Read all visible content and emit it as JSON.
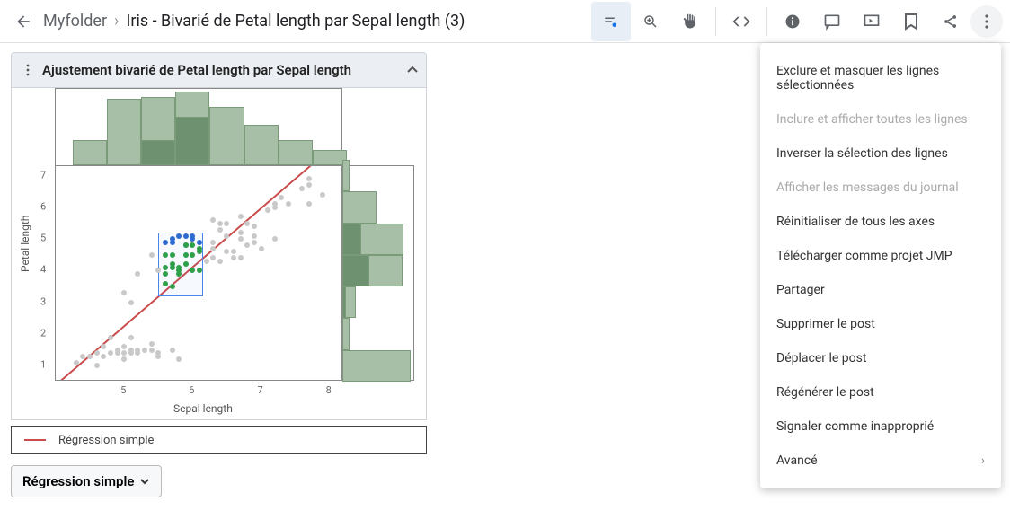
{
  "breadcrumb": {
    "folder": "Myfolder",
    "current": "Iris - Bivarié de Petal length par Sepal length (3)"
  },
  "panel": {
    "title": "Ajustement bivarié de Petal length par Sepal length"
  },
  "legend": {
    "label": "Régression simple"
  },
  "button": {
    "label": "Régression simple"
  },
  "axes": {
    "x": "Sepal length",
    "y": "Petal length"
  },
  "ticks": {
    "x": [
      "5",
      "6",
      "7",
      "8"
    ],
    "y": [
      "1",
      "2",
      "3",
      "4",
      "5",
      "6",
      "7"
    ]
  },
  "menu": {
    "items": [
      {
        "label": "Exclure et masquer les lignes sélectionnées",
        "disabled": false
      },
      {
        "label": "Inclure et afficher toutes les lignes",
        "disabled": true
      },
      {
        "label": "Inverser la sélection des lignes",
        "disabled": false
      },
      {
        "label": "Afficher les messages du journal",
        "disabled": true
      },
      {
        "label": "Réinitialiser de tous les axes",
        "disabled": false
      },
      {
        "label": "Télécharger comme projet JMP",
        "disabled": false
      },
      {
        "label": "Partager",
        "disabled": false
      },
      {
        "label": "Supprimer le post",
        "disabled": false
      },
      {
        "label": "Déplacer le post",
        "disabled": false
      },
      {
        "label": "Régénérer le post",
        "disabled": false
      },
      {
        "label": "Signaler comme inapproprié",
        "disabled": false
      },
      {
        "label": "Avancé",
        "disabled": false,
        "arrow": true
      }
    ]
  },
  "chart_data": {
    "type": "scatter",
    "title": "Ajustement bivarié de Petal length par Sepal length",
    "xlabel": "Sepal length",
    "ylabel": "Petal length",
    "xlim": [
      4.0,
      8.2
    ],
    "ylim": [
      0.5,
      7.3
    ],
    "series": [
      {
        "name": "Unselected",
        "color": "#c9c9c9",
        "points": [
          [
            4.3,
            1.1
          ],
          [
            4.4,
            1.3
          ],
          [
            4.5,
            1.3
          ],
          [
            4.6,
            1.4
          ],
          [
            4.6,
            1.0
          ],
          [
            4.7,
            1.3
          ],
          [
            4.7,
            1.6
          ],
          [
            4.8,
            1.4
          ],
          [
            4.8,
            1.9
          ],
          [
            4.9,
            1.5
          ],
          [
            4.9,
            1.4
          ],
          [
            5.0,
            1.2
          ],
          [
            5.0,
            1.6
          ],
          [
            5.0,
            1.4
          ],
          [
            5.1,
            1.5
          ],
          [
            5.1,
            1.9
          ],
          [
            5.1,
            1.4
          ],
          [
            5.2,
            1.4
          ],
          [
            5.2,
            1.5
          ],
          [
            5.3,
            1.5
          ],
          [
            5.4,
            1.7
          ],
          [
            5.4,
            1.5
          ],
          [
            5.5,
            1.3
          ],
          [
            5.5,
            1.4
          ],
          [
            5.7,
            1.5
          ],
          [
            5.8,
            1.2
          ],
          [
            5.0,
            3.3
          ],
          [
            5.1,
            3.0
          ],
          [
            5.2,
            3.9
          ],
          [
            5.4,
            4.5
          ],
          [
            5.5,
            4.0
          ],
          [
            5.6,
            3.6
          ],
          [
            6.2,
            4.3
          ],
          [
            6.3,
            4.4
          ],
          [
            6.3,
            4.7
          ],
          [
            6.3,
            4.9
          ],
          [
            6.3,
            5.6
          ],
          [
            6.4,
            4.3
          ],
          [
            6.4,
            5.3
          ],
          [
            6.4,
            5.5
          ],
          [
            6.5,
            4.6
          ],
          [
            6.5,
            5.1
          ],
          [
            6.5,
            5.5
          ],
          [
            6.6,
            4.4
          ],
          [
            6.6,
            4.6
          ],
          [
            6.7,
            4.4
          ],
          [
            6.7,
            5.0
          ],
          [
            6.7,
            5.2
          ],
          [
            6.7,
            5.7
          ],
          [
            6.8,
            4.8
          ],
          [
            6.8,
            5.5
          ],
          [
            6.9,
            4.9
          ],
          [
            6.9,
            5.1
          ],
          [
            6.9,
            5.4
          ],
          [
            7.0,
            4.7
          ],
          [
            7.1,
            5.9
          ],
          [
            7.2,
            5.0
          ],
          [
            7.2,
            6.0
          ],
          [
            7.2,
            6.1
          ],
          [
            7.3,
            6.3
          ],
          [
            7.4,
            6.1
          ],
          [
            7.6,
            6.6
          ],
          [
            7.7,
            6.1
          ],
          [
            7.7,
            6.7
          ],
          [
            7.7,
            6.9
          ],
          [
            7.9,
            6.4
          ]
        ]
      },
      {
        "name": "Selected-blue",
        "color": "#2d6bd0",
        "points": [
          [
            5.6,
            4.9
          ],
          [
            5.7,
            5.0
          ],
          [
            5.8,
            5.1
          ],
          [
            5.9,
            5.1
          ],
          [
            5.9,
            4.8
          ],
          [
            6.0,
            5.0
          ],
          [
            6.0,
            5.1
          ],
          [
            6.1,
            4.9
          ],
          [
            5.7,
            4.9
          ]
        ]
      },
      {
        "name": "Selected-green",
        "color": "#2fa04a",
        "points": [
          [
            5.6,
            3.9
          ],
          [
            5.6,
            4.1
          ],
          [
            5.6,
            4.5
          ],
          [
            5.7,
            3.5
          ],
          [
            5.7,
            4.1
          ],
          [
            5.7,
            4.2
          ],
          [
            5.7,
            4.5
          ],
          [
            5.8,
            3.9
          ],
          [
            5.8,
            4.0
          ],
          [
            5.8,
            4.1
          ],
          [
            5.9,
            4.2
          ],
          [
            5.9,
            4.5
          ],
          [
            6.0,
            4.0
          ],
          [
            6.0,
            4.5
          ],
          [
            6.0,
            4.8
          ],
          [
            6.1,
            4.0
          ],
          [
            6.1,
            4.6
          ],
          [
            6.1,
            4.7
          ],
          [
            5.6,
            3.6
          ],
          [
            5.9,
            4.8
          ]
        ]
      }
    ],
    "regression": {
      "slope": 1.86,
      "intercept": -7.1,
      "color": "#c94b4b"
    },
    "selection_rect": {
      "x0": 5.5,
      "x1": 6.15,
      "y0": 3.2,
      "y1": 5.2
    },
    "x_histogram": {
      "bin_edges": [
        4.25,
        4.75,
        5.25,
        5.75,
        6.25,
        6.75,
        7.25,
        7.75,
        8.25
      ],
      "counts": [
        10,
        26,
        27,
        29,
        23,
        16,
        10,
        6
      ],
      "selected": [
        0,
        0,
        10,
        19,
        0,
        0,
        0,
        0
      ]
    },
    "y_histogram": {
      "bin_edges": [
        0.5,
        1.5,
        2.5,
        3.5,
        4.5,
        5.5,
        6.5,
        7.5
      ],
      "counts": [
        40,
        4,
        8,
        35,
        36,
        20,
        4
      ],
      "selected": [
        0,
        0,
        2,
        16,
        11,
        0,
        0
      ]
    }
  }
}
